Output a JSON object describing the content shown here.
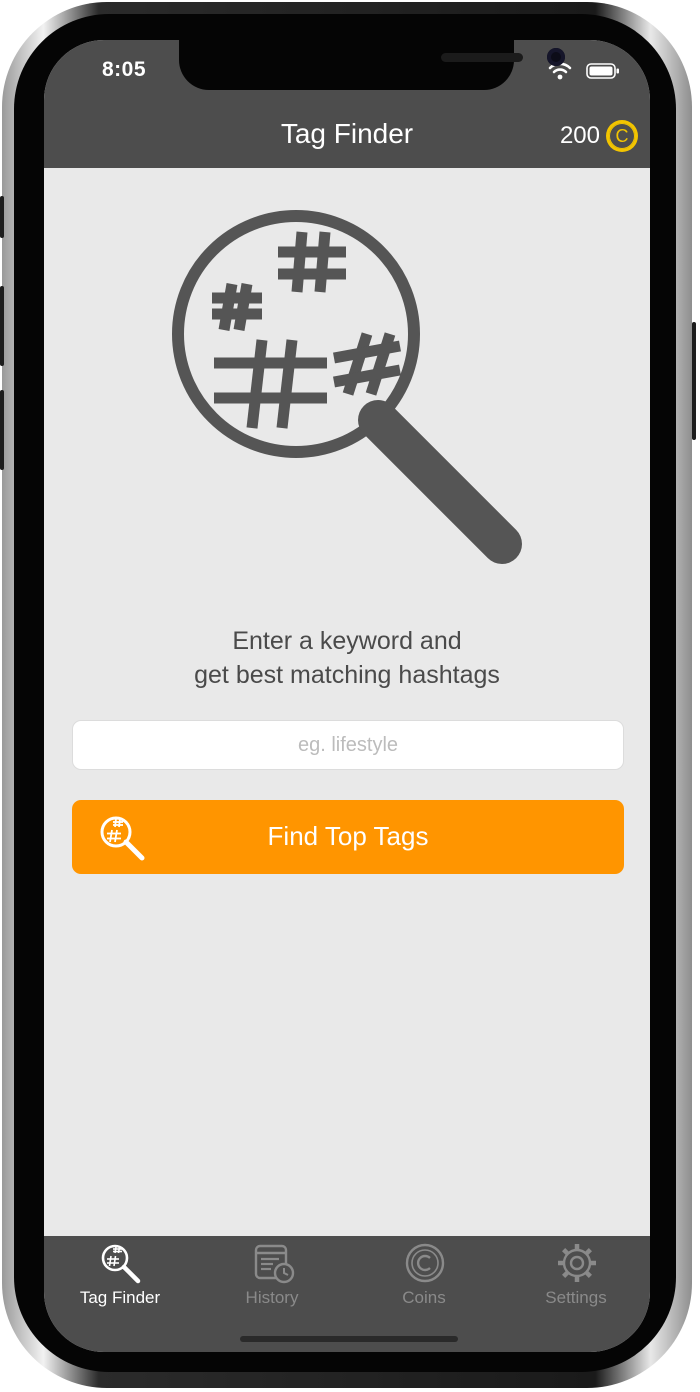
{
  "status_bar": {
    "time": "8:05"
  },
  "nav": {
    "title": "Tag Finder",
    "coin_count": "200",
    "coin_symbol": "C"
  },
  "main": {
    "tagline_line1": "Enter a keyword and",
    "tagline_line2": "get best matching hashtags",
    "search": {
      "placeholder": "eg. lifestyle",
      "value": ""
    },
    "find_button_label": "Find Top Tags"
  },
  "tabs": [
    {
      "label": "Tag Finder",
      "icon": "tag-finder-icon",
      "active": true
    },
    {
      "label": "History",
      "icon": "history-icon",
      "active": false
    },
    {
      "label": "Coins",
      "icon": "coins-icon",
      "active": false
    },
    {
      "label": "Settings",
      "icon": "settings-icon",
      "active": false
    }
  ],
  "colors": {
    "accent": "#ff9500",
    "bar": "#4d4d4d",
    "background": "#e9e9e9",
    "coin": "#f3c500",
    "icon_gray": "#555555"
  }
}
